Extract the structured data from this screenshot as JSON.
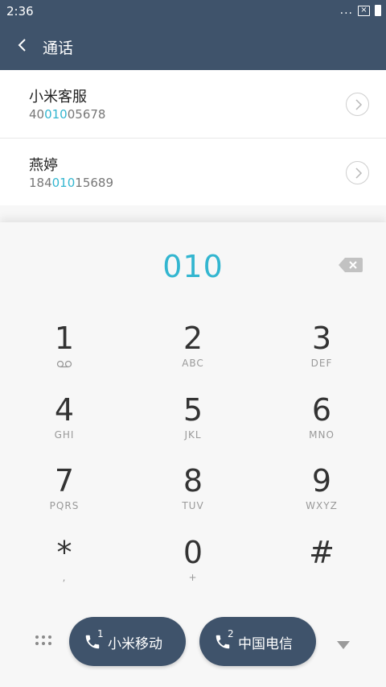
{
  "status": {
    "time": "2:36",
    "more": "...",
    "sim_icon": "sim-disabled-icon",
    "battery_icon": "battery-icon"
  },
  "header": {
    "title": "通话"
  },
  "results": [
    {
      "name": "小米客服",
      "num_pre": "40",
      "num_match": "010",
      "num_post": "05678"
    },
    {
      "name": "燕婷",
      "num_pre": "184",
      "num_match": "010",
      "num_post": "15689"
    }
  ],
  "dialer": {
    "number": "010",
    "keys": [
      {
        "digit": "1",
        "sub": ""
      },
      {
        "digit": "2",
        "sub": "ABC"
      },
      {
        "digit": "3",
        "sub": "DEF"
      },
      {
        "digit": "4",
        "sub": "GHI"
      },
      {
        "digit": "5",
        "sub": "JKL"
      },
      {
        "digit": "6",
        "sub": "MNO"
      },
      {
        "digit": "7",
        "sub": "PQRS"
      },
      {
        "digit": "8",
        "sub": "TUV"
      },
      {
        "digit": "9",
        "sub": "WXYZ"
      },
      {
        "digit": "*",
        "sub": ","
      },
      {
        "digit": "0",
        "sub": "+"
      },
      {
        "digit": "#",
        "sub": ""
      }
    ]
  },
  "calls": {
    "sim1": {
      "num": "1",
      "label": "小米移动"
    },
    "sim2": {
      "num": "2",
      "label": "中国电信"
    }
  },
  "colors": {
    "header_bg": "#3f536b",
    "accent": "#33b6d0",
    "call_bg": "#3f536b"
  }
}
